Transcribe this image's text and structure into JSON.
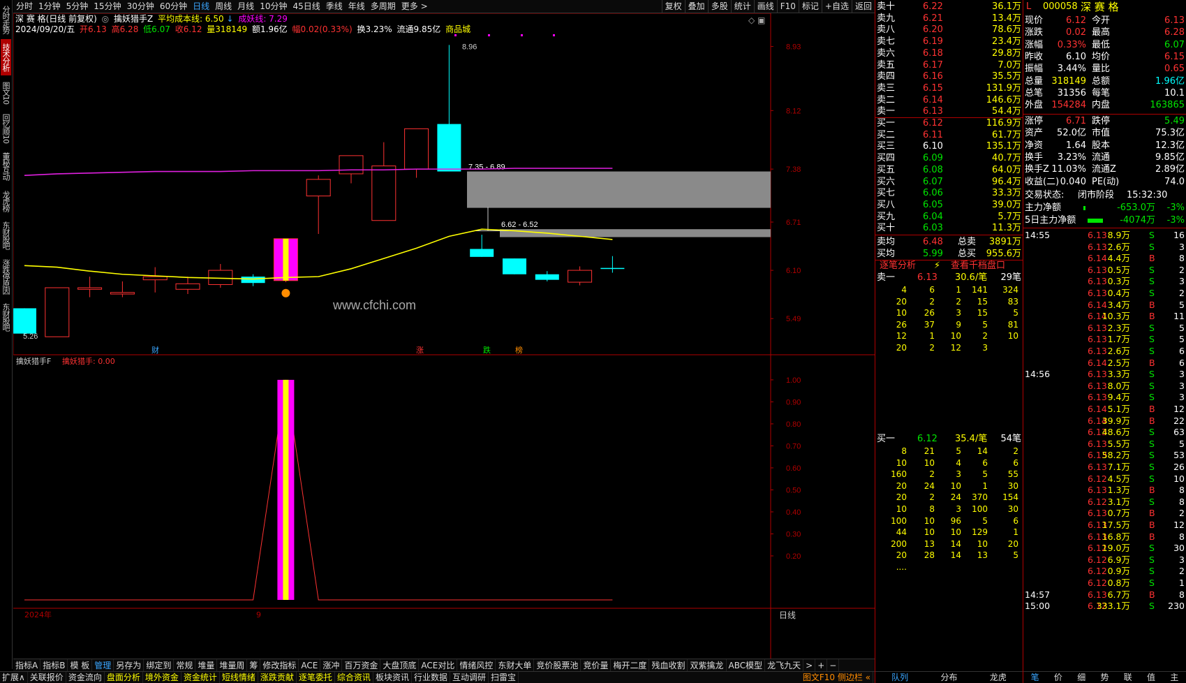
{
  "left_tabs": [
    "分时走势",
    "技术分析",
    "图文10",
    "回忆顺10",
    "董秘互动",
    "龙虎榜",
    "东财股吧",
    "涨跌停原因",
    "东财股吧"
  ],
  "top_tabs": [
    "分时",
    "1分钟",
    "5分钟",
    "15分钟",
    "30分钟",
    "60分钟",
    "日线",
    "周线",
    "月线",
    "10分钟",
    "45日线",
    "季线",
    "年线",
    "多周期",
    "更多 >"
  ],
  "top_right_tabs": [
    "复权",
    "叠加",
    "多股",
    "统计",
    "画线",
    "F10",
    "标记",
    "+自选",
    "返回"
  ],
  "header": {
    "stock_name": "深 赛 格(日线 前复权)",
    "indicator_name": "擒妖猎手Z",
    "avg_cost_label": "平均成本线: 6.50",
    "avg_cost_arrow": "↓",
    "chengyao_label": "成妖线: 7.29",
    "date": "2024/09/20/五",
    "open": "开6.13",
    "high": "高6.28",
    "low": "低6.07",
    "close": "收6.12",
    "volume": "量318149",
    "amount": "额1.96亿",
    "change": "幅0.02(0.33%)",
    "turnover": "换3.23%",
    "float": "流通9.85亿",
    "sector": "商品城"
  },
  "price_axis": [
    "8.93",
    "8.12",
    "7.38",
    "6.71",
    "6.10",
    "5.49"
  ],
  "sub_axis": [
    "1.00",
    "0.90",
    "0.80",
    "0.70",
    "0.60",
    "0.50",
    "0.40",
    "0.30",
    "0.20"
  ],
  "sub_header": {
    "name": "擒妖猎手F",
    "value": "擒妖猎手: 0.00"
  },
  "annotations": {
    "high": "8.96",
    "low": "5.26",
    "box1": "7.35 - 6.89",
    "box2": "6.62 - 6.52",
    "watermark": "www.cfchi.com",
    "date_start": "2024年",
    "date_mark": "9",
    "period": "日线",
    "x_marks": [
      "财",
      "涨",
      "跌",
      "榜"
    ]
  },
  "chart_data": {
    "type": "candlestick",
    "ylim": [
      5.2,
      9.05
    ],
    "candles": [
      {
        "o": 5.62,
        "h": 5.62,
        "l": 5.28,
        "c": 5.3
      },
      {
        "o": 5.26,
        "h": 5.88,
        "l": 5.26,
        "c": 5.88
      },
      {
        "o": 5.86,
        "h": 6.02,
        "l": 5.76,
        "c": 5.88
      },
      {
        "o": 5.8,
        "h": 5.96,
        "l": 5.76,
        "c": 5.82
      },
      {
        "o": 5.98,
        "h": 6.14,
        "l": 5.82,
        "c": 6.02
      },
      {
        "o": 5.86,
        "h": 6.02,
        "l": 5.8,
        "c": 5.93
      },
      {
        "o": 5.92,
        "h": 6.18,
        "l": 5.88,
        "c": 6.1
      },
      {
        "o": 6.02,
        "h": 6.05,
        "l": 5.9,
        "c": 5.94
      },
      {
        "o": 5.97,
        "h": 6.5,
        "l": 5.95,
        "c": 6.5
      },
      {
        "o": 7.04,
        "h": 7.3,
        "l": 6.56,
        "c": 7.25
      },
      {
        "o": 7.32,
        "h": 7.52,
        "l": 7.2,
        "c": 7.55
      },
      {
        "o": 6.73,
        "h": 7.72,
        "l": 6.73,
        "c": 7.42
      },
      {
        "o": 7.38,
        "h": 7.89,
        "l": 7.27,
        "c": 7.89
      },
      {
        "o": 7.95,
        "h": 8.95,
        "l": 7.35,
        "c": 7.35
      },
      {
        "o": 6.37,
        "h": 6.55,
        "l": 6.27,
        "c": 6.27
      },
      {
        "o": 6.25,
        "h": 6.25,
        "l": 6.05,
        "c": 6.05
      },
      {
        "o": 6.05,
        "h": 6.09,
        "l": 5.96,
        "c": 5.98
      },
      {
        "o": 5.95,
        "h": 6.15,
        "l": 5.91,
        "c": 6.1
      },
      {
        "o": 6.13,
        "h": 6.28,
        "l": 6.07,
        "c": 6.12
      }
    ],
    "avg_cost_line": 6.5,
    "chengyao_line": [
      7.3,
      7.32,
      7.33,
      7.34,
      7.35,
      7.35,
      7.35,
      7.36,
      7.36,
      7.36,
      7.37,
      7.37,
      7.38,
      7.38,
      7.38,
      7.39,
      7.39,
      7.39,
      7.39
    ],
    "yellow_line": [
      6.16,
      6.14,
      6.09,
      6.05,
      6.03,
      6.01,
      6.0,
      5.99,
      6.01,
      6.02,
      6.12,
      6.25,
      6.38,
      6.53,
      6.62,
      6.6,
      6.57,
      6.53,
      6.49
    ],
    "sub_ylim": [
      0,
      1.06
    ],
    "sub_values": [
      0,
      0,
      0,
      0,
      0,
      0,
      0,
      0,
      1,
      0,
      0,
      0,
      0,
      0,
      0,
      0,
      0,
      0,
      0
    ]
  },
  "order_book": {
    "asks": [
      [
        "卖十",
        "6.22",
        "36.1万"
      ],
      [
        "卖九",
        "6.21",
        "13.4万"
      ],
      [
        "卖八",
        "6.20",
        "78.6万"
      ],
      [
        "卖七",
        "6.19",
        "23.4万"
      ],
      [
        "卖六",
        "6.18",
        "29.8万"
      ],
      [
        "卖五",
        "6.17",
        "7.0万"
      ],
      [
        "卖四",
        "6.16",
        "35.5万"
      ],
      [
        "卖三",
        "6.15",
        "131.9万"
      ],
      [
        "卖二",
        "6.14",
        "146.6万"
      ],
      [
        "卖一",
        "6.13",
        "54.4万"
      ]
    ],
    "bids": [
      [
        "买一",
        "6.12",
        "116.9万"
      ],
      [
        "买二",
        "6.11",
        "61.7万"
      ],
      [
        "买三",
        "6.10",
        "135.1万"
      ],
      [
        "买四",
        "6.09",
        "40.7万"
      ],
      [
        "买五",
        "6.08",
        "64.0万"
      ],
      [
        "买六",
        "6.07",
        "96.4万"
      ],
      [
        "买七",
        "6.06",
        "33.3万"
      ],
      [
        "买八",
        "6.05",
        "39.0万"
      ],
      [
        "买九",
        "6.04",
        "5.7万"
      ],
      [
        "买十",
        "6.03",
        "11.3万"
      ]
    ],
    "avg_sell_label": "卖均",
    "avg_sell": "6.48",
    "total_sell_label": "总卖",
    "total_sell": "3891万",
    "avg_buy_label": "买均",
    "avg_buy": "5.99",
    "total_buy_label": "总买",
    "total_buy": "955.6万",
    "link1": "逐笔分析",
    "link2": "查看千档盘口",
    "sell1_label": "卖一",
    "sell1_price": "6.13",
    "sell1_avg": "30.6/笔",
    "sell1_count": "29笔",
    "sell1_grid": [
      [
        "4",
        "6",
        "1",
        "141",
        "324"
      ],
      [
        "20",
        "2",
        "2",
        "15",
        "83"
      ],
      [
        "10",
        "26",
        "3",
        "15",
        "5"
      ],
      [
        "26",
        "37",
        "9",
        "5",
        "81"
      ],
      [
        "12",
        "1",
        "10",
        "2",
        "10"
      ],
      [
        "20",
        "2",
        "12",
        "3",
        ""
      ]
    ],
    "buy1_label": "买一",
    "buy1_price": "6.12",
    "buy1_avg": "35.4/笔",
    "buy1_count": "54笔",
    "buy1_grid": [
      [
        "8",
        "21",
        "5",
        "14",
        "2"
      ],
      [
        "10",
        "10",
        "4",
        "6",
        "6"
      ],
      [
        "160",
        "2",
        "3",
        "5",
        "55"
      ],
      [
        "20",
        "24",
        "10",
        "1",
        "30"
      ],
      [
        "20",
        "2",
        "24",
        "370",
        "154"
      ],
      [
        "10",
        "8",
        "3",
        "100",
        "30"
      ],
      [
        "100",
        "10",
        "96",
        "5",
        "6"
      ],
      [
        "44",
        "10",
        "10",
        "129",
        "1"
      ],
      [
        "200",
        "13",
        "14",
        "10",
        "20"
      ],
      [
        "20",
        "28",
        "14",
        "13",
        "5"
      ],
      [
        "....",
        "",
        "",
        "",
        ""
      ]
    ]
  },
  "quote": {
    "code": "000058",
    "name": "深 赛 格",
    "rows": [
      [
        "现价",
        "6.12",
        "今开",
        "6.13"
      ],
      [
        "涨跌",
        "0.02",
        "最高",
        "6.28"
      ],
      [
        "涨幅",
        "0.33%",
        "最低",
        "6.07"
      ],
      [
        "昨收",
        "6.10",
        "均价",
        "6.15"
      ],
      [
        "振幅",
        "3.44%",
        "量比",
        "0.65"
      ],
      [
        "总量",
        "318149",
        "总额",
        "1.96亿"
      ],
      [
        "总笔",
        "31356",
        "每笔",
        "10.1"
      ],
      [
        "外盘",
        "154284",
        "内盘",
        "163865"
      ]
    ],
    "rows2": [
      [
        "涨停",
        "6.71",
        "跌停",
        "5.49"
      ],
      [
        "资产",
        "52.0亿",
        "市值",
        "75.3亿"
      ],
      [
        "净资",
        "1.64",
        "股本",
        "12.3亿"
      ],
      [
        "换手",
        "3.23%",
        "流通",
        "9.85亿"
      ],
      [
        "换手Z",
        "11.03%",
        "流通Z",
        "2.89亿"
      ],
      [
        "收益(二)",
        "0.040",
        "PE(动)",
        "74.0"
      ]
    ],
    "status_label": "交易状态:",
    "status": "闭市阶段",
    "time": "15:32:30",
    "flow1_label": "主力净额",
    "flow1": "-653.0万",
    "flow1_pct": "-3%",
    "flow2_label": "5日主力净额",
    "flow2": "-4074万",
    "flow2_pct": "-3%",
    "ticks": [
      [
        "14:55",
        "6.13",
        "8.9万",
        "S",
        "16"
      ],
      [
        "",
        "6.13",
        "2.6万",
        "S",
        "3"
      ],
      [
        "",
        "6.14",
        "4.4万",
        "B",
        "8"
      ],
      [
        "",
        "6.13",
        "0.5万",
        "S",
        "2"
      ],
      [
        "",
        "6.13",
        "0.3万",
        "S",
        "3"
      ],
      [
        "",
        "6.13",
        "0.4万",
        "S",
        "2"
      ],
      [
        "",
        "6.14",
        "3.4万",
        "B",
        "5"
      ],
      [
        "",
        "6.14",
        "10.3万",
        "B",
        "11"
      ],
      [
        "",
        "6.13",
        "2.3万",
        "S",
        "5"
      ],
      [
        "",
        "6.13",
        "1.7万",
        "S",
        "5"
      ],
      [
        "",
        "6.13",
        "2.6万",
        "S",
        "6"
      ],
      [
        "",
        "6.14",
        "2.5万",
        "B",
        "6"
      ],
      [
        "14:56",
        "6.13",
        "3.3万",
        "S",
        "3"
      ],
      [
        "",
        "6.13",
        "8.0万",
        "S",
        "3"
      ],
      [
        "",
        "6.13",
        "9.4万",
        "S",
        "3"
      ],
      [
        "",
        "6.14",
        "5.1万",
        "B",
        "12"
      ],
      [
        "",
        "6.14",
        "39.9万",
        "B",
        "22"
      ],
      [
        "",
        "6.13",
        "48.6万",
        "S",
        "63"
      ],
      [
        "",
        "6.13",
        "5.5万",
        "S",
        "5"
      ],
      [
        "",
        "6.13",
        "58.2万",
        "S",
        "53"
      ],
      [
        "",
        "6.13",
        "7.1万",
        "S",
        "26"
      ],
      [
        "",
        "6.12",
        "4.5万",
        "S",
        "10"
      ],
      [
        "",
        "6.13",
        "1.3万",
        "B",
        "8"
      ],
      [
        "",
        "6.12",
        "3.1万",
        "S",
        "8"
      ],
      [
        "",
        "6.13",
        "0.7万",
        "B",
        "2"
      ],
      [
        "",
        "6.13",
        "17.5万",
        "B",
        "12"
      ],
      [
        "",
        "6.13",
        "16.8万",
        "B",
        "8"
      ],
      [
        "",
        "6.12",
        "19.0万",
        "S",
        "30"
      ],
      [
        "",
        "6.12",
        "6.9万",
        "S",
        "3"
      ],
      [
        "",
        "6.12",
        "0.9万",
        "S",
        "2"
      ],
      [
        "",
        "6.12",
        "0.8万",
        "S",
        "1"
      ],
      [
        "14:57",
        "6.13",
        "6.7万",
        "B",
        "8"
      ],
      [
        "15:00",
        "6.12",
        "333.1万",
        "S",
        "230"
      ]
    ]
  },
  "bottom_tabs": [
    "指标A",
    "指标B",
    "模 板",
    "管理",
    "另存为",
    "绑定到",
    "常规",
    "堆量",
    "堆量周",
    "筹",
    "修改指标",
    "ACE",
    "涨冲",
    "百万资金",
    "大盘顶底",
    "ACE对比",
    "情绪风控",
    "东财大单",
    "竞价股票池",
    "竞价量",
    "梅开二度",
    "残血收割",
    "双紫擒龙",
    "ABC模型",
    "龙飞九天"
  ],
  "bottom_tab_nav": [
    ">",
    "+",
    "−"
  ],
  "status_tabs": [
    "扩展∧",
    "关联报价",
    "资金流向",
    "盘面分析",
    "境外资金",
    "资金统计",
    "短线情绪",
    "涨跌贡献",
    "逐笔委托",
    "综合资讯",
    "板块资讯",
    "行业数据",
    "互动调研",
    "扫雷宝"
  ],
  "status_right": "图文F10 侧边栏 «",
  "book_bottom_tabs": [
    "队列",
    "分布",
    "龙虎"
  ],
  "quote_bottom_tabs": [
    "笔",
    "价",
    "细",
    "势",
    "联",
    "值",
    "主"
  ],
  "colors": {
    "up": "#ff3232",
    "down": "#00ffff",
    "bg": "#000000",
    "axis_red": "#b00000",
    "text_yellow": "#ffff00",
    "green": "#00e600",
    "magenta": "#ff00ff"
  }
}
